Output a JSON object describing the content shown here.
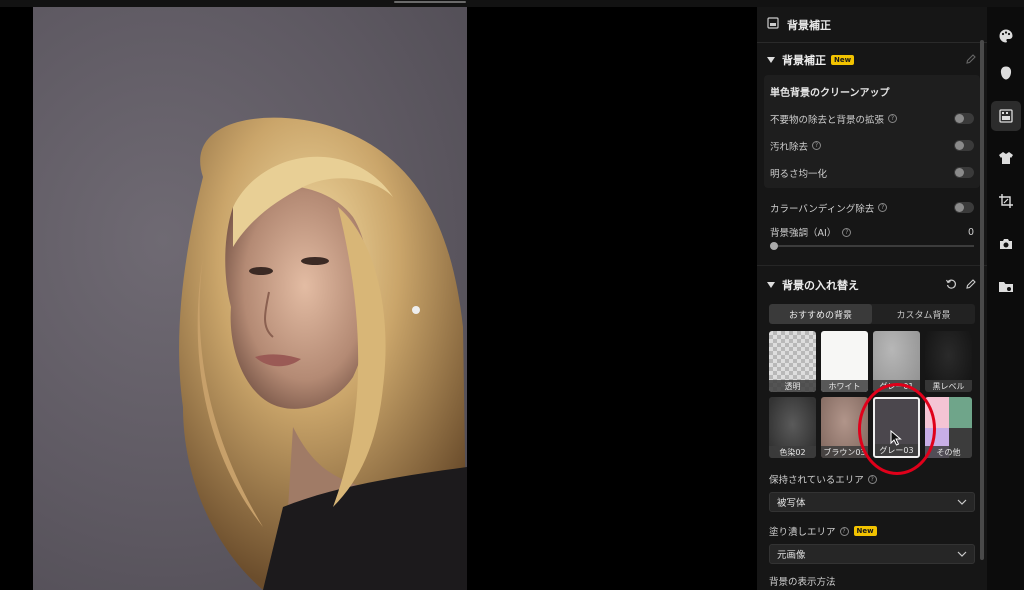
{
  "panel": {
    "title": "背景補正",
    "section1": {
      "title": "背景補正",
      "badge": "New"
    },
    "cleanup": {
      "title": "単色背景のクリーンアップ",
      "rows": [
        {
          "label": "不要物の除去と背景の拡張",
          "help": true
        },
        {
          "label": "汚れ除去",
          "help": true
        },
        {
          "label": "明るさ均一化",
          "help": false
        }
      ]
    },
    "banding": {
      "label": "カラーバンディング除去"
    },
    "enhance": {
      "label": "背景強調（AI）",
      "value": "0",
      "level": 0
    },
    "section2": {
      "title": "背景の入れ替え"
    },
    "tabs": {
      "recommended": "おすすめの背景",
      "custom": "カスタム背景"
    },
    "tiles": [
      {
        "label": "透明"
      },
      {
        "label": "ホワイト"
      },
      {
        "label": "グレー01"
      },
      {
        "label": "黒レベル"
      },
      {
        "label": "色染02"
      },
      {
        "label": "ブラウン03"
      },
      {
        "label": "グレー03"
      },
      {
        "label": "その他"
      }
    ],
    "kept_area": {
      "label": "保持されているエリア",
      "value": "被写体"
    },
    "fill_area": {
      "label": "塗り潰しエリア",
      "badge": "New",
      "value": "元画像"
    },
    "display_method": {
      "label": "背景の表示方法"
    }
  },
  "colors": {
    "accent_badge": "#f2c300",
    "highlight_ring": "#e0001a"
  },
  "rail": [
    "palette-icon",
    "face-icon",
    "background-icon",
    "shirt-icon",
    "crop-icon",
    "camera-icon",
    "folder-icon"
  ]
}
